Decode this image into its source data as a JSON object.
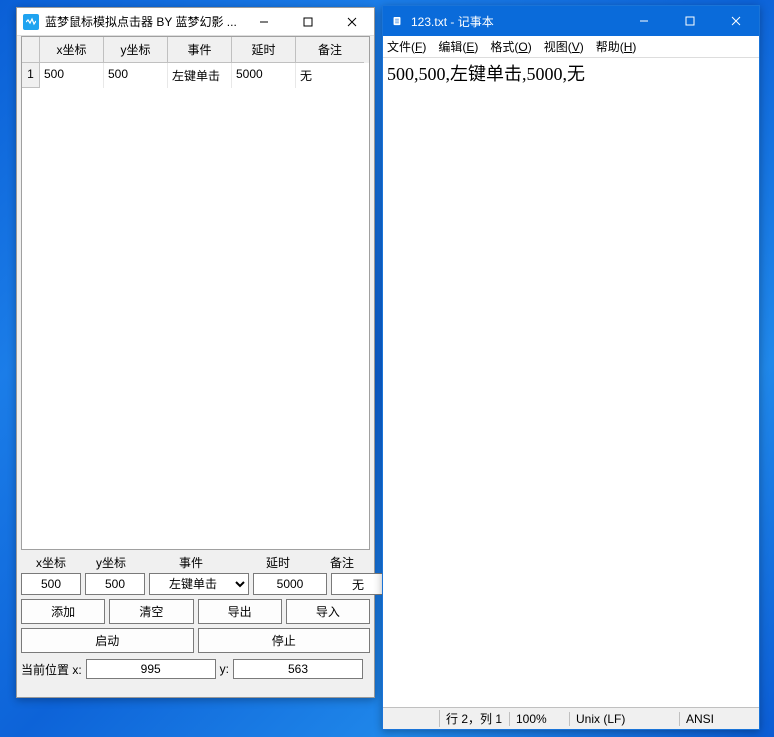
{
  "clicker": {
    "title": "蓝梦鼠标模拟点击器 BY 蓝梦幻影 ...",
    "columns": [
      "",
      "x坐标",
      "y坐标",
      "事件",
      "延时",
      "备注"
    ],
    "rows": [
      {
        "idx": "1",
        "x": "500",
        "y": "500",
        "evt": "左键单击",
        "delay": "5000",
        "note": "无"
      }
    ],
    "labels": {
      "x": "x坐标",
      "y": "y坐标",
      "evt": "事件",
      "delay": "延时",
      "note": "备注"
    },
    "inputs": {
      "x": "500",
      "y": "500",
      "evt": "左键单击",
      "delay": "5000",
      "note": "无"
    },
    "buttons": {
      "add": "添加",
      "clear": "清空",
      "export": "导出",
      "import": "导入",
      "start": "启动",
      "stop": "停止"
    },
    "pos": {
      "label": "当前位置 x:",
      "x": "995",
      "ylabel": "y:",
      "y": "563"
    }
  },
  "notepad": {
    "title": "123.txt - 记事本",
    "menu": {
      "file": "文件(F)",
      "edit": "编辑(E)",
      "format": "格式(O)",
      "view": "视图(V)",
      "help": "帮助(H)"
    },
    "content": "500,500,左键单击,5000,无",
    "status": {
      "pos": "行 2，列 1",
      "zoom": "100%",
      "eol": "Unix (LF)",
      "enc": "ANSI"
    }
  }
}
